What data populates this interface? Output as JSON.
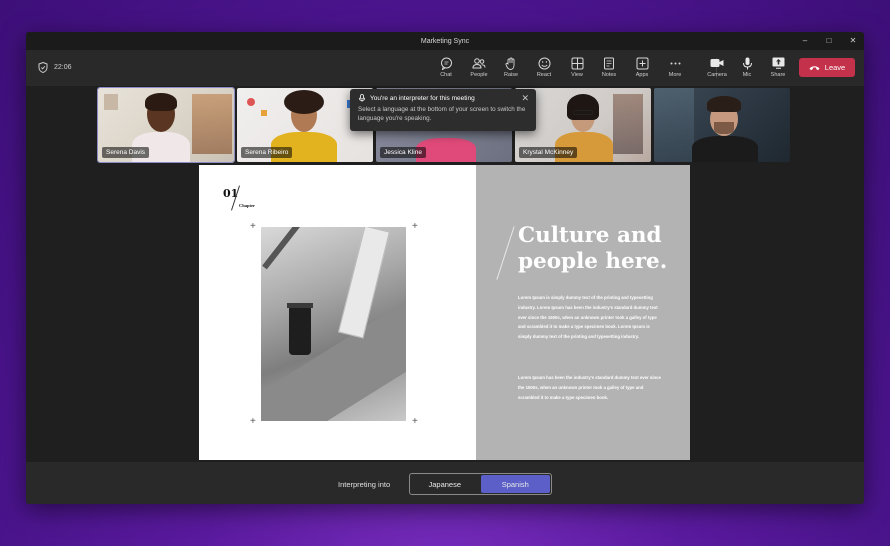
{
  "window": {
    "title": "Marketing Sync"
  },
  "toolbar": {
    "timer": "22:06",
    "buttons": [
      {
        "label": "Chat",
        "icon": "chat-icon"
      },
      {
        "label": "People",
        "icon": "people-icon"
      },
      {
        "label": "Raise",
        "icon": "raise-hand-icon"
      },
      {
        "label": "React",
        "icon": "react-icon"
      },
      {
        "label": "View",
        "icon": "view-icon"
      },
      {
        "label": "Notes",
        "icon": "notes-icon"
      },
      {
        "label": "Apps",
        "icon": "apps-icon"
      },
      {
        "label": "More",
        "icon": "more-icon"
      },
      {
        "label": "Camera",
        "icon": "camera-icon"
      },
      {
        "label": "Mic",
        "icon": "mic-icon"
      },
      {
        "label": "Share",
        "icon": "share-icon"
      }
    ],
    "leave_label": "Leave",
    "leave_color": "#c4314b"
  },
  "participants": [
    {
      "name": "Serena Davis"
    },
    {
      "name": "Serena Ribeiro"
    },
    {
      "name": "Jessica Kline"
    },
    {
      "name": "Krystal McKinney"
    },
    {
      "name": ""
    }
  ],
  "tooltip": {
    "title": "You're an interpreter for this meeting",
    "body": "Select a language at the bottom of your screen to switch the language you're speaking."
  },
  "slide": {
    "chapter_number": "01",
    "chapter_label": "Chapter",
    "headline_line1": "Culture and",
    "headline_line2": "people here.",
    "paragraph1": "Lorem Ipsum is simply dummy text of the printing and typesetting industry. Lorem Ipsum has been the industry's standard dummy text ever since the 1500s, when an unknown printer took a galley of type and scrambled it to make a type specimen book. Lorem Ipsum is simply dummy text of the printing and typesetting industry.",
    "paragraph2": "Lorem Ipsum has been the industry's standard dummy text ever since the 1500s, when an unknown printer took a galley of type and scrambled it to make a type specimen book."
  },
  "interpretation": {
    "label": "Interpreting into",
    "languages": [
      "Japanese",
      "Spanish"
    ],
    "selected": "Spanish",
    "accent": "#5b5fc7"
  }
}
